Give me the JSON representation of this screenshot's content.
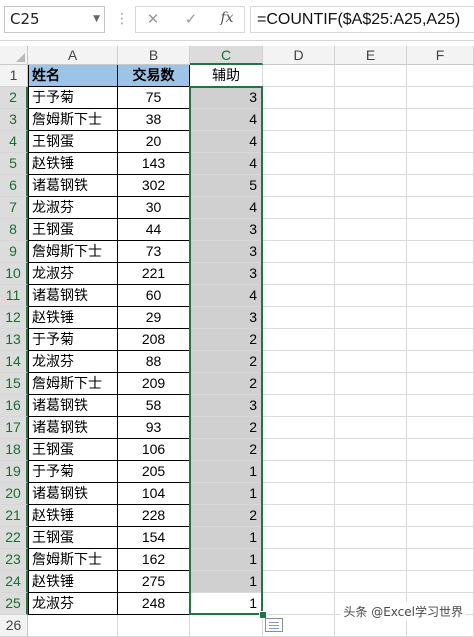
{
  "formula_bar": {
    "name_box": "C25",
    "formula": "=COUNTIF($A$25:A25,A25)",
    "cancel_glyph": "✕",
    "enter_glyph": "✓",
    "fx_glyph": "fx",
    "more_glyph": "⋮"
  },
  "columns": [
    "A",
    "B",
    "C",
    "D",
    "E",
    "F"
  ],
  "header_row": {
    "row": "1",
    "a": "姓名",
    "b": "交易数",
    "c": "辅助",
    "fill_color": "#9dc3e6"
  },
  "rows": [
    {
      "row": "2",
      "name": "于予菊",
      "count": "75",
      "helper": "3"
    },
    {
      "row": "3",
      "name": "詹姆斯下士",
      "count": "38",
      "helper": "4"
    },
    {
      "row": "4",
      "name": "王钢蛋",
      "count": "20",
      "helper": "4"
    },
    {
      "row": "5",
      "name": "赵铁锤",
      "count": "143",
      "helper": "4"
    },
    {
      "row": "6",
      "name": "诸葛钢铁",
      "count": "302",
      "helper": "5"
    },
    {
      "row": "7",
      "name": "龙淑芬",
      "count": "30",
      "helper": "4"
    },
    {
      "row": "8",
      "name": "王钢蛋",
      "count": "44",
      "helper": "3"
    },
    {
      "row": "9",
      "name": "詹姆斯下士",
      "count": "73",
      "helper": "3"
    },
    {
      "row": "10",
      "name": "龙淑芬",
      "count": "221",
      "helper": "3"
    },
    {
      "row": "11",
      "name": "诸葛钢铁",
      "count": "60",
      "helper": "4"
    },
    {
      "row": "12",
      "name": "赵铁锤",
      "count": "29",
      "helper": "3"
    },
    {
      "row": "13",
      "name": "于予菊",
      "count": "208",
      "helper": "2"
    },
    {
      "row": "14",
      "name": "龙淑芬",
      "count": "88",
      "helper": "2"
    },
    {
      "row": "15",
      "name": "詹姆斯下士",
      "count": "209",
      "helper": "2"
    },
    {
      "row": "16",
      "name": "诸葛钢铁",
      "count": "58",
      "helper": "3"
    },
    {
      "row": "17",
      "name": "诸葛钢铁",
      "count": "93",
      "helper": "2"
    },
    {
      "row": "18",
      "name": "王钢蛋",
      "count": "106",
      "helper": "2"
    },
    {
      "row": "19",
      "name": "于予菊",
      "count": "205",
      "helper": "1"
    },
    {
      "row": "20",
      "name": "诸葛钢铁",
      "count": "104",
      "helper": "1"
    },
    {
      "row": "21",
      "name": "赵铁锤",
      "count": "228",
      "helper": "2"
    },
    {
      "row": "22",
      "name": "王钢蛋",
      "count": "154",
      "helper": "1"
    },
    {
      "row": "23",
      "name": "詹姆斯下士",
      "count": "162",
      "helper": "1"
    },
    {
      "row": "24",
      "name": "赵铁锤",
      "count": "275",
      "helper": "1"
    },
    {
      "row": "25",
      "name": "龙淑芬",
      "count": "248",
      "helper": "1"
    }
  ],
  "trailing_row": "26",
  "selection": {
    "range": "C2:C25",
    "active_cell": "C25",
    "accent": "#217346",
    "fill": "#d0d0d0"
  },
  "watermark": "头条 @Excel学习世界",
  "icons": {
    "quick_analysis": "quick-analysis-icon"
  }
}
